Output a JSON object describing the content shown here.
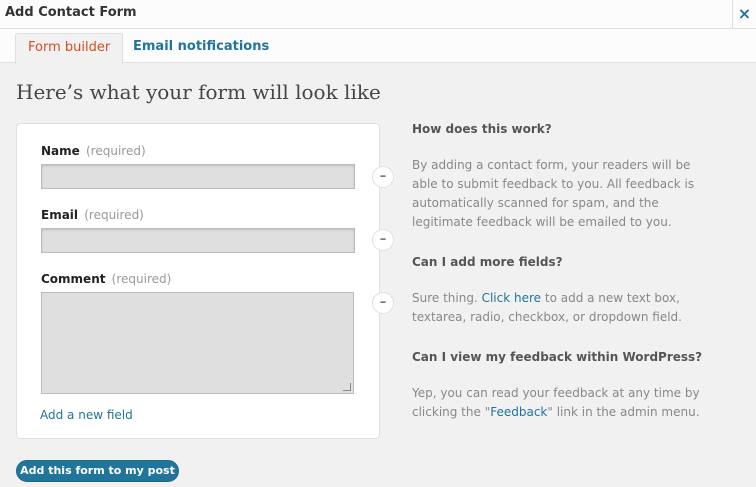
{
  "window": {
    "title": "Add Contact Form",
    "close_glyph": "×"
  },
  "tabs": [
    {
      "label": "Form builder",
      "active": true
    },
    {
      "label": "Email notifications",
      "active": false
    }
  ],
  "heading": "Here’s what your form will look like",
  "form": {
    "fields": [
      {
        "label": "Name",
        "required_text": "(required)",
        "type": "text"
      },
      {
        "label": "Email",
        "required_text": "(required)",
        "type": "text"
      },
      {
        "label": "Comment",
        "required_text": "(required)",
        "type": "textarea"
      }
    ],
    "remove_glyph": "–",
    "add_field_label": "Add a new field"
  },
  "help": {
    "q1": "How does this work?",
    "a1": "By adding a contact form, your readers will be able to submit feedback to you. All feedback is automatically scanned for spam, and the legitimate feedback will be emailed to you.",
    "q2": "Can I add more fields?",
    "a2_pre": "Sure thing. ",
    "a2_link": "Click here",
    "a2_post": " to add a new text box, textarea, radio, checkbox, or dropdown field.",
    "q3": "Can I view my feedback within WordPress?",
    "a3_pre": "Yep, you can read your feedback at any time by clicking the \"",
    "a3_link": "Feedback",
    "a3_post": "\" link in the admin menu."
  },
  "submit_label": "Add this form to my post",
  "colors": {
    "link": "#21759b",
    "active_tab": "#d54e21",
    "background": "#f1f1f1"
  },
  "icons": {
    "close": "close-icon",
    "remove": "minus-icon"
  }
}
